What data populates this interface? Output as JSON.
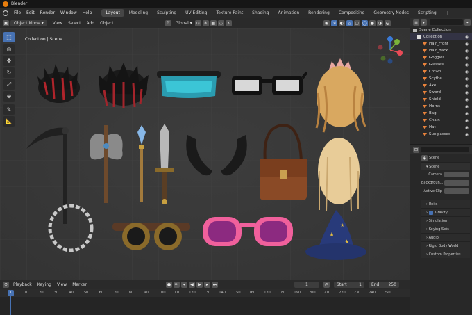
{
  "app": {
    "title": "Blender"
  },
  "menu": [
    "File",
    "Edit",
    "Render",
    "Window",
    "Help"
  ],
  "workspaces": [
    "Layout",
    "Modeling",
    "Sculpting",
    "UV Editing",
    "Texture Paint",
    "Shading",
    "Animation",
    "Rendering",
    "Compositing",
    "Geometry Nodes",
    "Scripting"
  ],
  "active_workspace": "Layout",
  "viewport_header": {
    "mode": "Object Mode",
    "menus": [
      "View",
      "Select",
      "Add",
      "Object"
    ],
    "orientation": "Global"
  },
  "viewport": {
    "scene_label": "Collection | Scene",
    "objects": [
      "Hair_Front",
      "Hair_Back",
      "Goggles",
      "Glasses",
      "Crown",
      "Scythe",
      "Axe",
      "Sword",
      "Shield",
      "Horns",
      "Bag",
      "Chain",
      "Hat",
      "Sunglasses"
    ]
  },
  "outliner": {
    "root": "Scene Collection",
    "collection": "Collection",
    "items": [
      "Hair_Front",
      "Hair_Back",
      "Goggles",
      "Glasses",
      "Crown",
      "Scythe",
      "Axe",
      "Sword",
      "Shield",
      "Horns",
      "Bag",
      "Chain",
      "Hat",
      "Sunglasses"
    ]
  },
  "properties": {
    "title": "Scene",
    "panel": "Scene",
    "fields": [
      {
        "label": "Camera",
        "value": ""
      },
      {
        "label": "Backgroun...",
        "value": ""
      },
      {
        "label": "Active Clip",
        "value": ""
      }
    ],
    "sections": [
      "Units",
      "Gravity",
      "Simulation",
      "Keying Sets",
      "Audio",
      "Rigid Body World",
      "Custom Properties"
    ]
  },
  "timeline": {
    "menus": [
      "Playback",
      "Keying",
      "View",
      "Marker"
    ],
    "current_frame": "1",
    "start_label": "Start",
    "start": "1",
    "end_label": "End",
    "end": "250",
    "ticks": [
      "1",
      "10",
      "20",
      "30",
      "40",
      "50",
      "60",
      "70",
      "80",
      "90",
      "100",
      "110",
      "120",
      "130",
      "140",
      "150",
      "160",
      "170",
      "180",
      "190",
      "200",
      "210",
      "220",
      "230",
      "240",
      "250"
    ]
  },
  "colors": {
    "accent": "#4772b3",
    "viewport_bg": "#3a3a3a",
    "object_orange": "#e8823b",
    "blender_orange": "#e87d0d"
  }
}
